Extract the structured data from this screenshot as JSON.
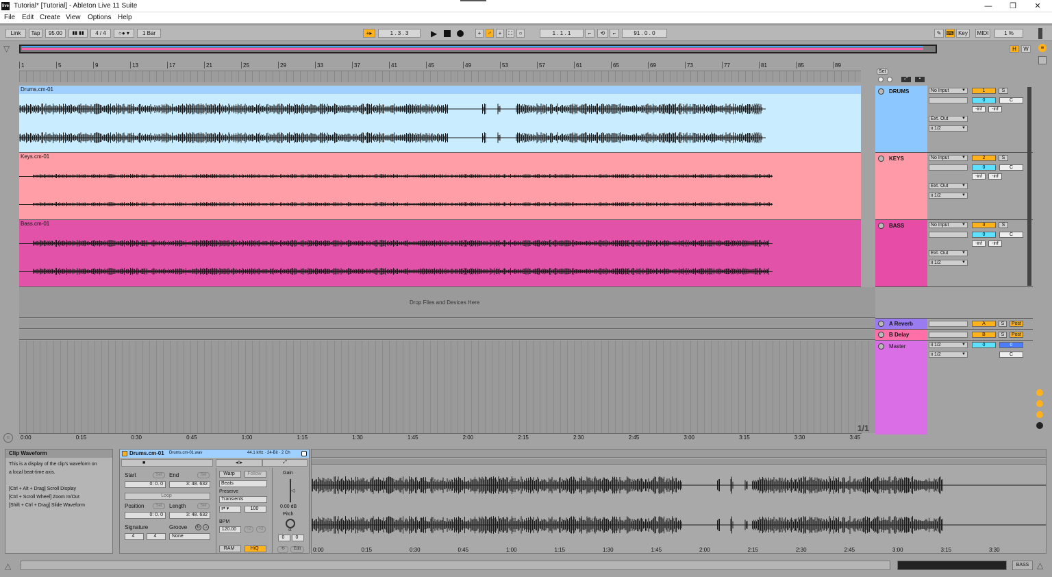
{
  "window": {
    "title": "Tutorial*  [Tutorial] - Ableton Live 11 Suite",
    "app_badge": "live",
    "min": "—",
    "max": "❐",
    "close": "✕"
  },
  "menu": [
    "File",
    "Edit",
    "Create",
    "View",
    "Options",
    "Help"
  ],
  "transport": {
    "link": "Link",
    "tap": "Tap",
    "tempo": "95.00",
    "signature": "4 / 4",
    "quantize": "1 Bar",
    "arrangement_position": "1 .  3 .  3",
    "loop_start": "1 .  1 .  1",
    "loop_length": "91 .  0 .  0",
    "key": "Key",
    "midi": "MIDI",
    "cpu": "1 %"
  },
  "ruler": {
    "bars": [
      "1",
      "5",
      "9",
      "13",
      "17",
      "21",
      "25",
      "29",
      "33",
      "37",
      "41",
      "45",
      "49",
      "53",
      "57",
      "61",
      "65",
      "69",
      "73",
      "77",
      "81",
      "85",
      "89"
    ]
  },
  "time_ruler": [
    "0:00",
    "0:15",
    "0:30",
    "0:45",
    "1:00",
    "1:15",
    "1:30",
    "1:45",
    "2:00",
    "2:15",
    "2:30",
    "2:45",
    "3:00",
    "3:15",
    "3:30",
    "3:45"
  ],
  "tracks": [
    {
      "clip": "Drums.cm-01",
      "name": "DRUMS",
      "input": "No Input",
      "output": "Ext. Out",
      "channel": "ii 1/2",
      "number": "1",
      "vol": "0",
      "pan": "C",
      "meter_l": "-inf",
      "meter_r": "-inf",
      "color": "#8cc8ff",
      "clip_color": "#c6ecff",
      "header_color": "#9fd0ff"
    },
    {
      "clip": "Keys.cm-01",
      "name": "KEYS",
      "input": "No Input",
      "output": "Ext. Out",
      "channel": "ii 1/2",
      "number": "2",
      "vol": "0",
      "pan": "C",
      "meter_l": "-inf",
      "meter_r": "-inf",
      "color": "#ff9aa8",
      "clip_color": "#ff9ea6",
      "header_color": "#ff9ea6"
    },
    {
      "clip": "Bass.cm-01",
      "name": "BASS",
      "input": "No Input",
      "output": "Ext. Out",
      "channel": "ii 1/2",
      "number": "3",
      "vol": "0",
      "pan": "C",
      "meter_l": "-inf",
      "meter_r": "-inf",
      "color": "#e74da7",
      "clip_color": "#e252a8",
      "header_color": "#e252a8"
    }
  ],
  "drop_text": "Drop Files and Devices Here",
  "returns": [
    {
      "name": "A Reverb",
      "letter": "A",
      "post": "Post",
      "color": "#9b7cf0"
    },
    {
      "name": "B Delay",
      "letter": "B",
      "post": "Post",
      "color": "#ff6fa8"
    }
  ],
  "master": {
    "name": "Master",
    "channel1": "ii 1/2",
    "channel2": "ii 1/2",
    "vol": "0",
    "vol2": "0",
    "pan": "C",
    "color": "#d96ee6"
  },
  "set_label": "Set",
  "page_counter": "1/1",
  "info": {
    "title": "Clip Waveform",
    "lines": [
      "This is a display of the clip's waveform on",
      "a local beat-time axis.",
      "",
      "[Ctrl + Alt + Drag] Scroll Display",
      "[Ctrl + Scroll Wheel] Zoom In/Out",
      "[Shift + Ctrl + Drag] Slide Waveform"
    ]
  },
  "clip_view": {
    "name": "Drums.cm-01",
    "file": "Drums.cm-01.wav",
    "format": "44.1 kHz · 24-Bit · 2 Ch",
    "start_label": "Start",
    "end_label": "End",
    "set": "Set",
    "start": [
      "0:",
      "0.",
      "0"
    ],
    "end": [
      "3:",
      "48. 632"
    ],
    "loop": "Loop",
    "position_label": "Position",
    "length_label": "Length",
    "position": [
      "0:",
      "0.",
      "0"
    ],
    "length": [
      "3:",
      "48. 632"
    ],
    "signature_label": "Signature",
    "groove_label": "Groove",
    "sig_num": "4",
    "sig_den": "4",
    "groove": "None",
    "warp": "Warp",
    "follow": "Follow",
    "warp_mode": "Beats",
    "preserve_label": "Preserve",
    "preserve": "Transients",
    "loop_mode_value": "100",
    "bpm_label": "BPM",
    "bpm": "120.00",
    "half": "÷2",
    "double": "×2",
    "ram": "RAM",
    "hiq": "HiQ",
    "gain_label": "Gain",
    "gain": "0.00 dB",
    "pitch_label": "Pitch",
    "pitch_unit": "st",
    "pitch_st": "0",
    "pitch_ct": "0",
    "edit": "Edit"
  },
  "clip_time_ruler": [
    "0:00",
    "0:15",
    "0:30",
    "0:45",
    "1:00",
    "1:15",
    "1:30",
    "1:45",
    "2:00",
    "2:15",
    "2:30",
    "2:45",
    "3:00",
    "3:15",
    "3:30"
  ],
  "status": {
    "track": "BASS"
  }
}
